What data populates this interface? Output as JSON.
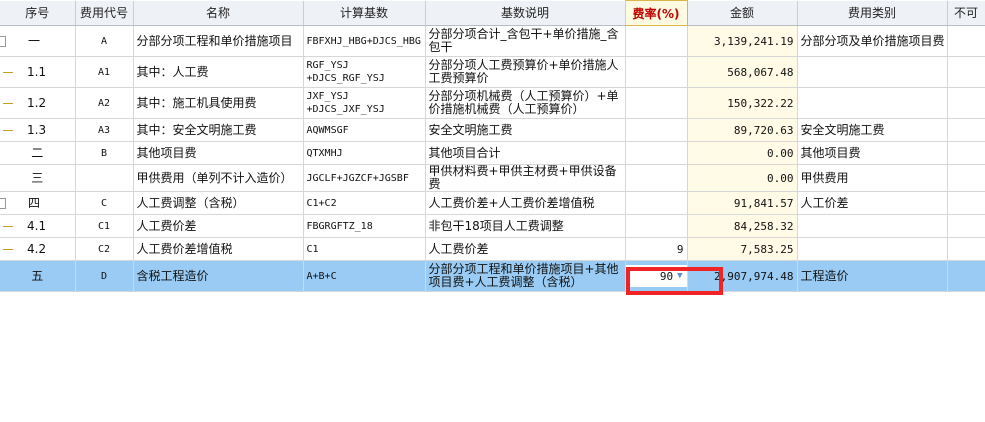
{
  "headers": {
    "seq": "序号",
    "code": "费用代号",
    "name": "名称",
    "base": "计算基数",
    "base_desc": "基数说明",
    "rate": "费率(%)",
    "amount": "金额",
    "category": "费用类别",
    "extra": "不可"
  },
  "rows": [
    {
      "seq": "一",
      "code": "A",
      "name": "分部分项工程和单价措施项目",
      "base": "FBFXHJ_HBG+DJCS_HBG",
      "desc": "分部分项合计_含包干+单价措施_含包干",
      "rate": "",
      "amount": "3,139,241.19",
      "category": "分部分项及单价措施项目费"
    },
    {
      "seq": "1.1",
      "code": "A1",
      "name": "其中：人工费",
      "base": "RGF_YSJ +DJCS_RGF_YSJ",
      "desc": "分部分项人工费预算价+单价措施人工费预算价",
      "rate": "",
      "amount": "568,067.48",
      "category": ""
    },
    {
      "seq": "1.2",
      "code": "A2",
      "name": "其中：施工机具使用费",
      "base": "JXF_YSJ +DJCS_JXF_YSJ",
      "desc": "分部分项机械费（人工预算价）+单价措施机械费（人工预算价）",
      "rate": "",
      "amount": "150,322.22",
      "category": ""
    },
    {
      "seq": "1.3",
      "code": "A3",
      "name": "其中：安全文明施工费",
      "base": "AQWMSGF",
      "desc": "安全文明施工费",
      "rate": "",
      "amount": "89,720.63",
      "category": "安全文明施工费"
    },
    {
      "seq": "二",
      "code": "B",
      "name": "其他项目费",
      "base": "QTXMHJ",
      "desc": "其他项目合计",
      "rate": "",
      "amount": "0.00",
      "category": "其他项目费"
    },
    {
      "seq": "三",
      "code": "",
      "name": "甲供费用（单列不计入造价）",
      "base": "JGCLF+JGZCF+JGSBF",
      "desc": "甲供材料费+甲供主材费+甲供设备费",
      "rate": "",
      "amount": "0.00",
      "category": "甲供费用"
    },
    {
      "seq": "四",
      "code": "C",
      "name": "人工费调整（含税）",
      "base": "C1+C2",
      "desc": "人工费价差+人工费价差增值税",
      "rate": "",
      "amount": "91,841.57",
      "category": "人工价差"
    },
    {
      "seq": "4.1",
      "code": "C1",
      "name": "人工费价差",
      "base": "FBGRGFTZ_18",
      "desc": "非包干18项目人工费调整",
      "rate": "",
      "amount": "84,258.32",
      "category": ""
    },
    {
      "seq": "4.2",
      "code": "C2",
      "name": "人工费价差增值税",
      "base": "C1",
      "desc": "人工费价差",
      "rate": "9",
      "amount": "7,583.25",
      "category": ""
    },
    {
      "seq": "五",
      "code": "D",
      "name": "含税工程造价",
      "base": "A+B+C",
      "desc": "分部分项工程和单价措施项目+其他项目费+人工费调整（含税）",
      "rate": "90",
      "amount": "2,907,974.48",
      "category": "工程造价"
    }
  ],
  "icons": {
    "dropdown": "chevron-down-icon"
  },
  "colors": {
    "selected_row": "#99cbf4",
    "amount_bg": "#fffbe7",
    "highlight_box": "#f02424",
    "rate_header_text": "#c40000"
  }
}
